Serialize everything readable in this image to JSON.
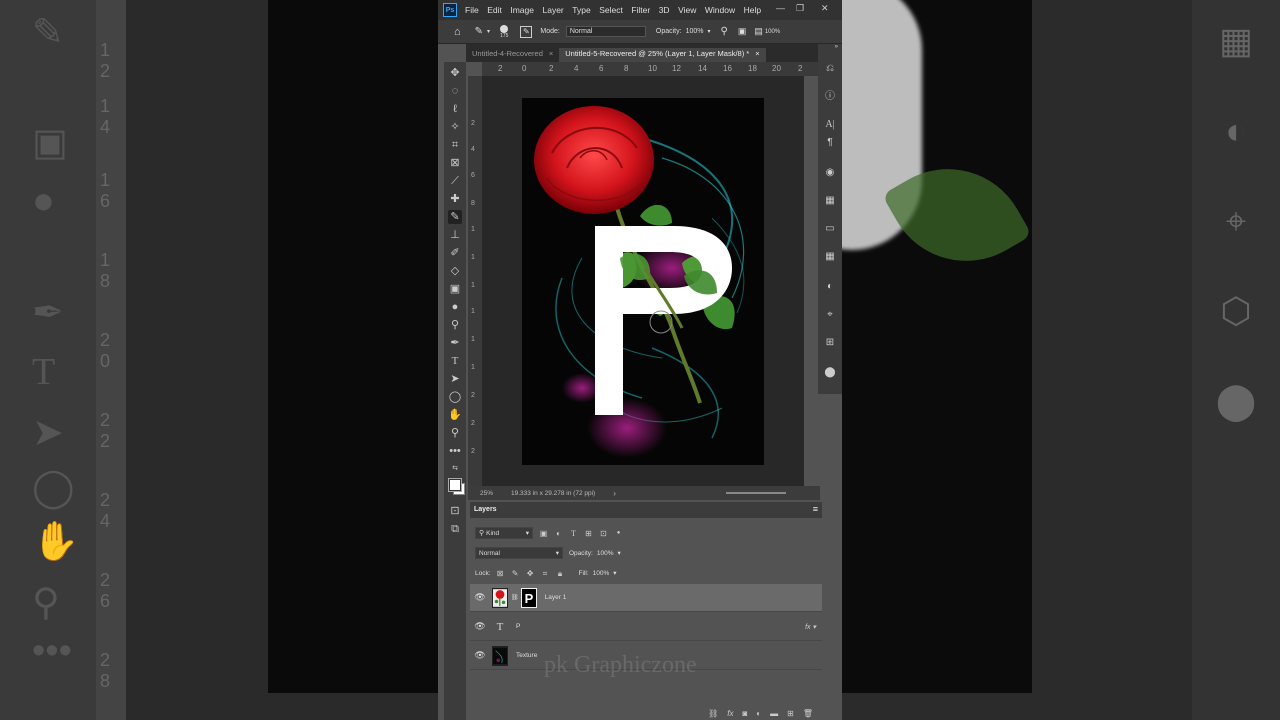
{
  "menubar": {
    "logo": "Ps",
    "items": [
      "File",
      "Edit",
      "Image",
      "Layer",
      "Type",
      "Select",
      "Filter",
      "3D",
      "View",
      "Window",
      "Help"
    ]
  },
  "options": {
    "brush_size": "175",
    "mode_label": "Mode:",
    "mode_value": "Normal",
    "opacity_label": "Opacity:",
    "opacity_value": "100%",
    "flow_value": "100%"
  },
  "tabs": [
    {
      "label": "Untitled-4-Recovered",
      "active": false
    },
    {
      "label": "Untitled-5-Recovered @ 25% (Layer 1, Layer Mask/8) *",
      "active": true
    }
  ],
  "ruler_top": [
    "2",
    "0",
    "2",
    "4",
    "6",
    "8",
    "10",
    "12",
    "14",
    "16",
    "18",
    "20",
    "2"
  ],
  "ruler_left": [
    "2",
    "4",
    "6",
    "8",
    "1",
    "1",
    "1",
    "1",
    "1",
    "1",
    "2",
    "2",
    "2"
  ],
  "status": {
    "zoom": "25%",
    "doc_info": "19.333 in x 29.278 in (72 ppi)"
  },
  "layers_panel": {
    "title": "Layers",
    "kind_label": "Kind",
    "blend_mode": "Normal",
    "opacity_label": "Opacity:",
    "opacity_value": "100%",
    "lock_label": "Lock:",
    "fill_label": "Fill:",
    "fill_value": "100%",
    "layers": [
      {
        "name": "Layer 1",
        "type": "image-with-mask",
        "selected": true
      },
      {
        "name": "P",
        "type": "text",
        "selected": false,
        "fx": "fx"
      },
      {
        "name": "Texture",
        "type": "image",
        "selected": false
      }
    ]
  },
  "watermark": "pk Graphiczone",
  "colors": {
    "accent": "#31a8ff",
    "rose": "#d4141c",
    "panel": "#535353"
  }
}
